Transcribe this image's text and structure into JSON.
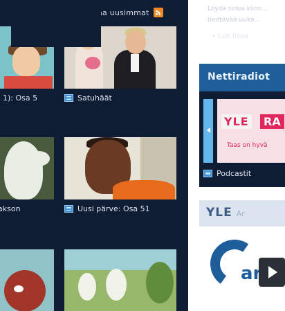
{
  "header": {
    "subscribe_label": "Tilaa uusimmat"
  },
  "grid": {
    "items": [
      {
        "caption": "1): Osa 5"
      },
      {
        "caption": "Satuhäät"
      },
      {
        "caption": "Muumilaakson"
      },
      {
        "caption": "Uusi pärve: Osa 51"
      }
    ]
  },
  "sidebar": {
    "intro_lines": [
      "Löydä sinua kiinn…",
      "tiedtävää uuka…"
    ],
    "read_more": "• Lue lisaa",
    "radio": {
      "title": "Nettiradiot",
      "banner_left": "YLE",
      "banner_right": "RA",
      "banner_slogan": "Taas on hyvä",
      "caption": "Podcastit"
    },
    "areena": {
      "logo": "YLE",
      "logo_suffix": "Ar",
      "brand_text": "are"
    }
  },
  "colors": {
    "panel_bg": "#0e1c34",
    "radio_header": "#1f5e98",
    "rss": "#f08a24",
    "yle_pink": "#e0265a"
  }
}
